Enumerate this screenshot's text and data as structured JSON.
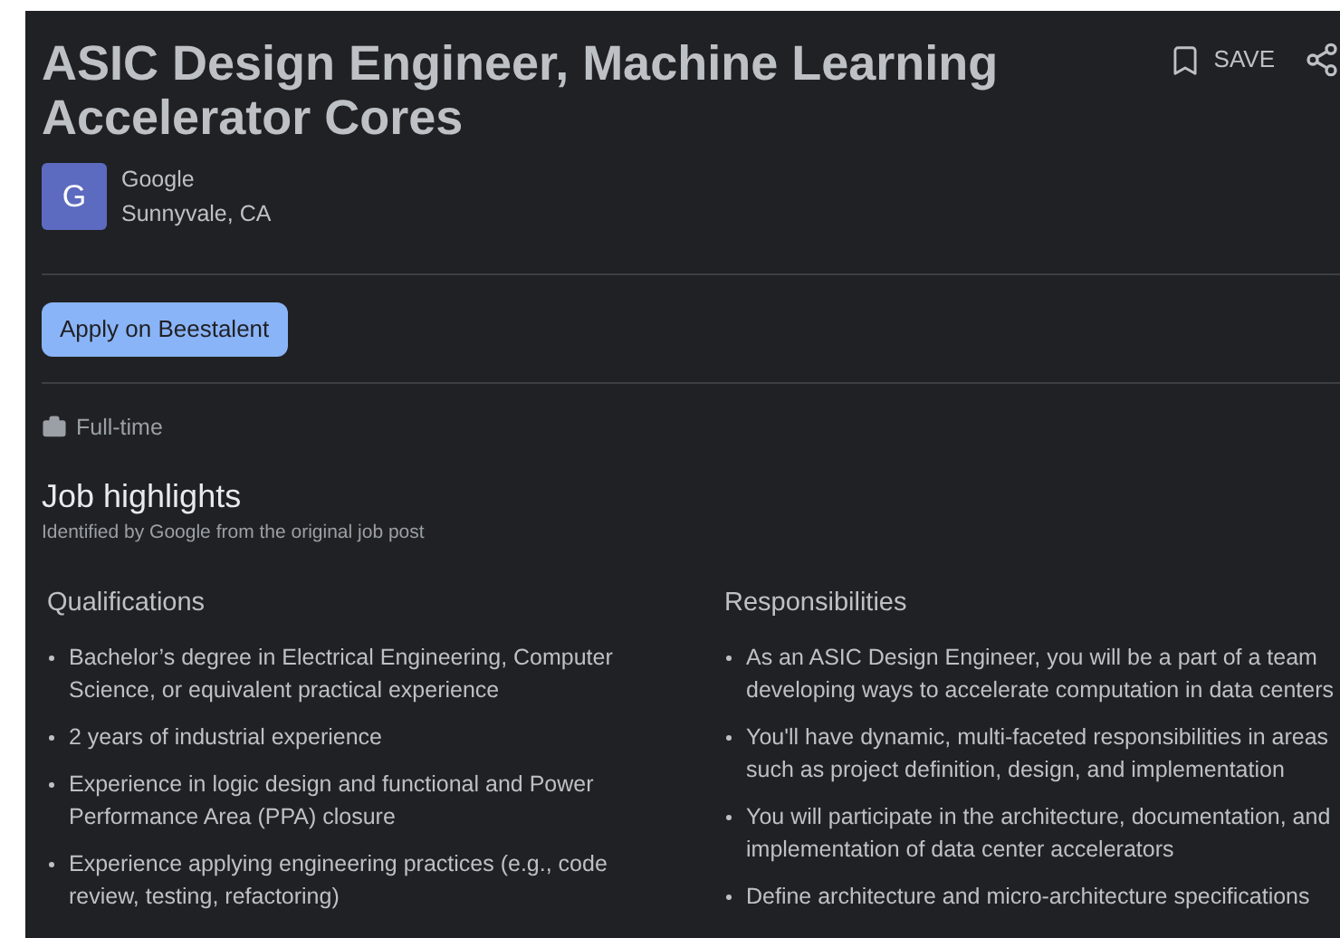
{
  "job": {
    "title": "ASIC Design Engineer, Machine Learning Accelerator Cores",
    "save_label": "SAVE",
    "company_initial": "G",
    "company": "Google",
    "location": "Sunnyvale, CA",
    "apply_button": "Apply on Beestalent",
    "employment_type": "Full-time"
  },
  "highlights": {
    "title": "Job highlights",
    "subtitle": "Identified by Google from the original job post",
    "sections": [
      {
        "title": "Qualifications",
        "items": [
          "Bachelor’s degree in Electrical Engineering, Computer Science, or equivalent practical experience",
          "2 years of industrial experience",
          "Experience in logic design and functional and Power Performance Area (PPA) closure",
          "Experience applying engineering practices (e.g., code review, testing, refactoring)"
        ]
      },
      {
        "title": "Responsibilities",
        "items": [
          "As an ASIC Design Engineer, you will be a part of a team developing ways to accelerate computation in data centers",
          "You'll have dynamic, multi-faceted responsibilities in areas such as project definition, design, and implementation",
          "You will participate in the architecture, documentation, and implementation of data center accelerators",
          "Define architecture and micro-architecture specifications"
        ]
      }
    ]
  }
}
